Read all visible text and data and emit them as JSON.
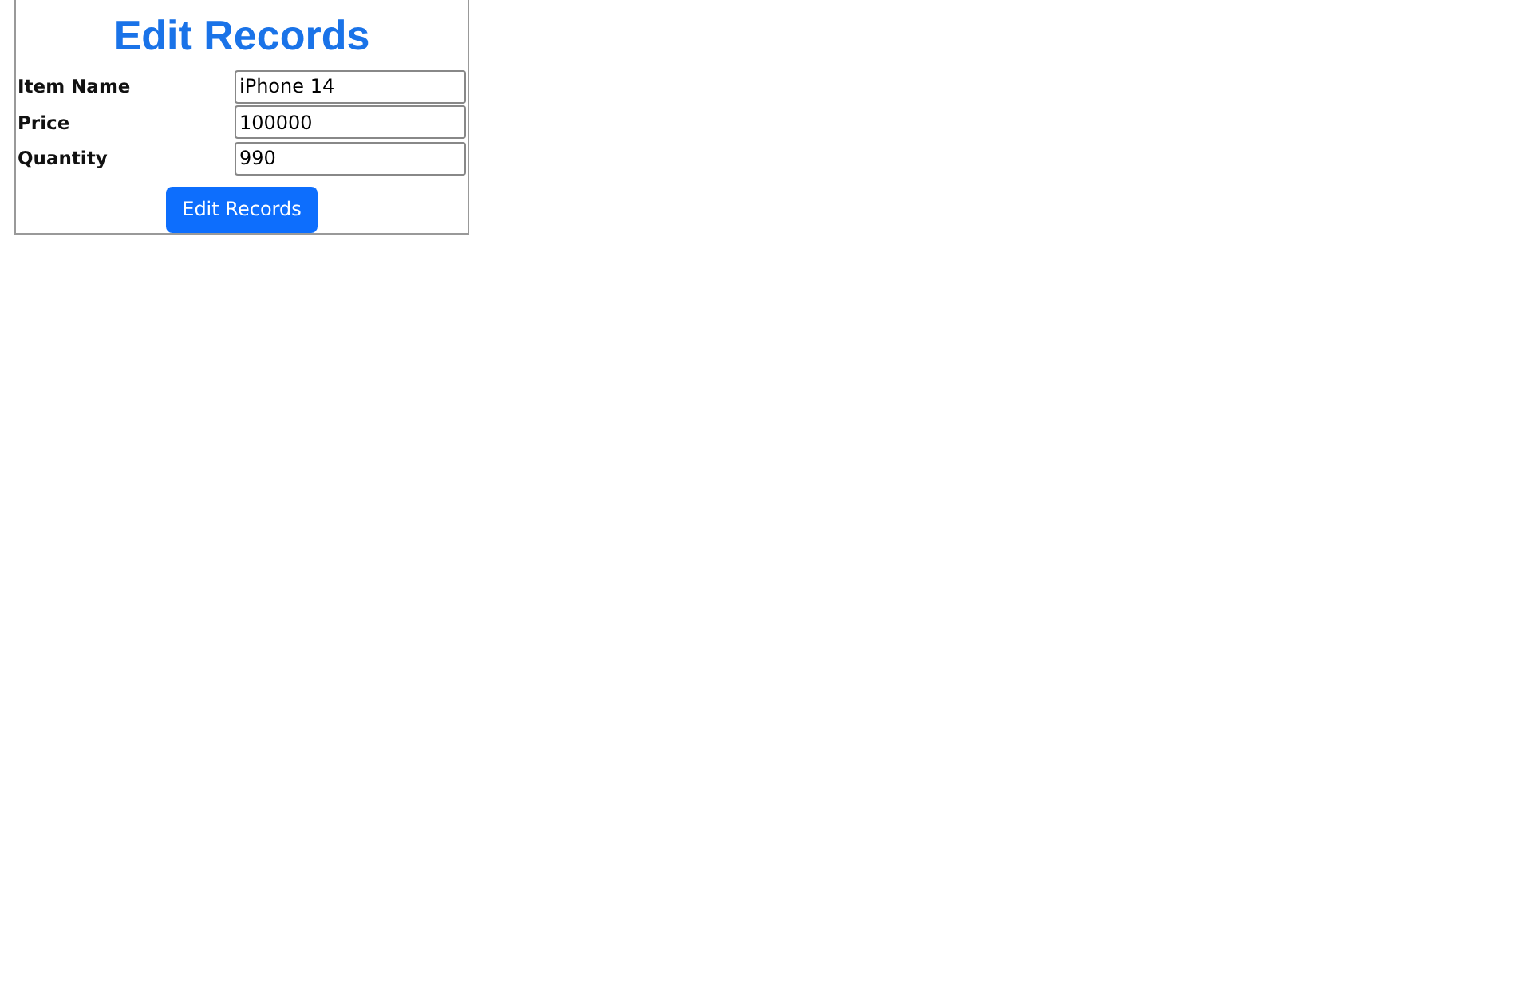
{
  "form": {
    "title": "Edit Records",
    "fields": [
      {
        "label": "Item Name",
        "value": "iPhone 14"
      },
      {
        "label": "Price",
        "value": "100000"
      },
      {
        "label": "Quantity",
        "value": "990"
      }
    ],
    "submit": "Edit Records"
  }
}
